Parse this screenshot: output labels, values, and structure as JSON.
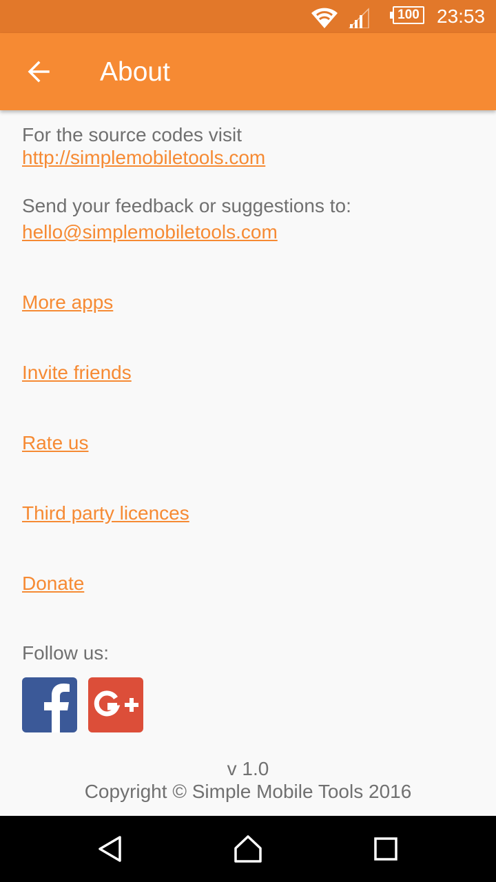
{
  "status_bar": {
    "battery": "100",
    "time": "23:53",
    "icons": [
      "wifi-icon",
      "cell-signal-icon",
      "battery-icon"
    ]
  },
  "toolbar": {
    "back_icon": "arrow-left-icon",
    "title": "About"
  },
  "content": {
    "source_label": "For the source codes visit",
    "source_link": "http://simplemobiletools.com",
    "feedback_label": "Send your feedback or suggestions to:",
    "feedback_email": "hello@simplemobiletools.com",
    "links": {
      "more_apps": "More apps",
      "invite_friends": "Invite friends",
      "rate_us": "Rate us",
      "third_party": "Third party licences",
      "donate": "Donate"
    },
    "follow_label": "Follow us:",
    "social_icons": [
      "facebook-icon",
      "google-plus-icon"
    ]
  },
  "footer": {
    "version": "v 1.0",
    "copyright": "Copyright © Simple Mobile Tools 2016"
  },
  "nav_bar": {
    "icons": [
      "back-triangle-icon",
      "home-icon",
      "recents-icon"
    ]
  },
  "colors": {
    "status_bar": "#e2782a",
    "toolbar": "#f68a33",
    "accent": "#f68a33",
    "text": "#707070",
    "background": "#f9f9f9",
    "facebook": "#3b5998",
    "google_plus": "#dc4e39"
  }
}
